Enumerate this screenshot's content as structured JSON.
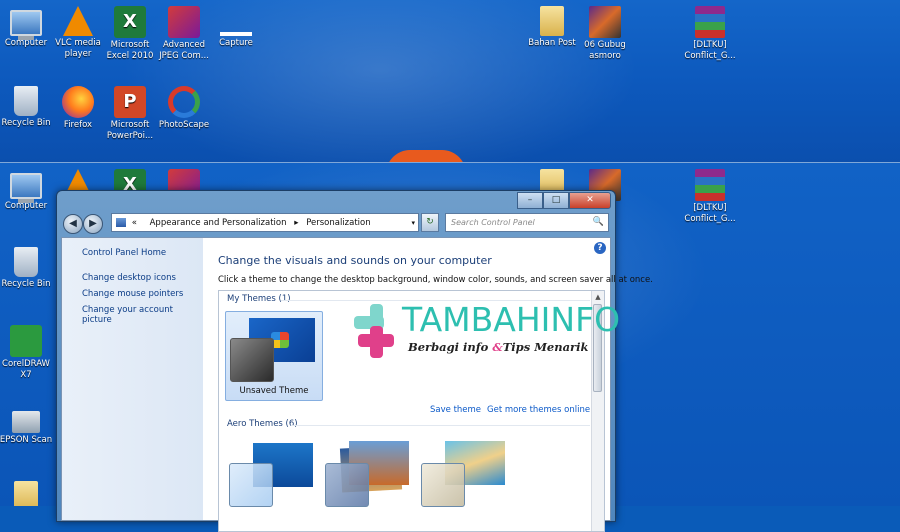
{
  "desktop_top": {
    "icons": [
      {
        "label": "Computer"
      },
      {
        "label": "VLC media player"
      },
      {
        "label": "Microsoft Excel 2010"
      },
      {
        "label": "Advanced JPEG Com..."
      },
      {
        "label": "Capture"
      },
      {
        "label": "Bahan Post"
      },
      {
        "label": "06 Gubug asmoro"
      },
      {
        "label": "[DLTKU] Conflict_G..."
      },
      {
        "label": "Recycle Bin"
      },
      {
        "label": "Firefox"
      },
      {
        "label": "Microsoft PowerPoi..."
      },
      {
        "label": "PhotoScape"
      }
    ]
  },
  "desktop_bottom": {
    "icons": [
      {
        "label": "Computer"
      },
      {
        "label": "Recycle Bin"
      },
      {
        "label": "CorelDRAW X7"
      },
      {
        "label": "EPSON Scan"
      },
      {
        "label": "[DLTKU] Conflict_G..."
      }
    ]
  },
  "window": {
    "nav": {
      "back": "◀",
      "forward": "▶"
    },
    "breadcrumb": {
      "prefix": "«",
      "parent": "Appearance and Personalization",
      "separator": "▸",
      "current": "Personalization",
      "dropdown": "▾"
    },
    "refresh": "↻",
    "search_placeholder": "Search Control Panel",
    "search_icon": "🔍",
    "caption": {
      "minimize": "–",
      "maximize": "□",
      "close": "✕"
    },
    "help": "?",
    "left_nav": {
      "home": "Control Panel Home",
      "links": [
        "Change desktop icons",
        "Change mouse pointers",
        "Change your account picture"
      ]
    },
    "heading": "Change the visuals and sounds on your computer",
    "subheading": "Click a theme to change the desktop background, window color, sounds, and screen saver all at once.",
    "sections": {
      "my_themes": "My Themes (1)",
      "aero_themes": "Aero Themes (6)"
    },
    "my_theme_name": "Unsaved Theme",
    "links": {
      "save": "Save theme",
      "more": "Get more themes online"
    },
    "scroll": {
      "up": "▲",
      "down": "▼"
    }
  },
  "watermark": {
    "brand": "TAMBAHINFO",
    "tagline_part1": "Berbagi info ",
    "tagline_amp": "&",
    "tagline_part2": "Tips Menarik",
    "colors": {
      "teal": "#2dbfb0",
      "pink": "#e0408a"
    }
  },
  "icon_names": [
    "computer-icon",
    "vlc-icon",
    "excel-icon",
    "jpeg-compressor-icon",
    "capture-icon",
    "folder-icon",
    "media-icon",
    "winrar-icon",
    "recycle-bin-icon",
    "firefox-icon",
    "powerpoint-icon",
    "photoscape-icon",
    "coreldraw-icon",
    "epson-scan-icon"
  ]
}
